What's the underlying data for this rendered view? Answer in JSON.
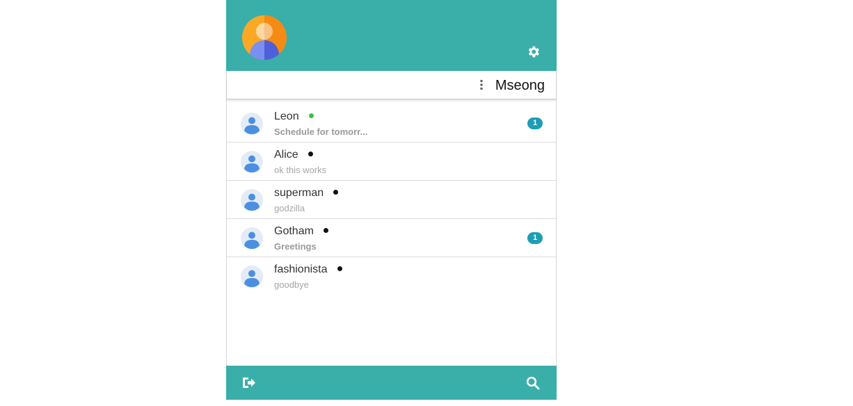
{
  "header": {
    "accent_color": "#3aaea9",
    "avatar_icon": "user-avatar-icon",
    "settings_icon": "gear-icon"
  },
  "subheader": {
    "username": "Mseong",
    "menu_icon": "kebab-menu-icon"
  },
  "contacts": [
    {
      "name": "Leon",
      "status": "online",
      "status_color": "#3dbf4a",
      "last_message": "Schedule for tomorr...",
      "unread": "1"
    },
    {
      "name": "Alice",
      "status": "offline",
      "status_color": "#111111",
      "last_message": "ok this works",
      "unread": ""
    },
    {
      "name": "superman",
      "status": "offline",
      "status_color": "#111111",
      "last_message": "godzilla",
      "unread": ""
    },
    {
      "name": "Gotham",
      "status": "offline",
      "status_color": "#111111",
      "last_message": "Greetings",
      "unread": "1"
    },
    {
      "name": "fashionista",
      "status": "offline",
      "status_color": "#111111",
      "last_message": "goodbye",
      "unread": ""
    }
  ],
  "footer": {
    "logout_icon": "sign-out-icon",
    "search_icon": "search-icon"
  },
  "colors": {
    "badge": "#1e9db5",
    "online": "#3dbf4a"
  }
}
